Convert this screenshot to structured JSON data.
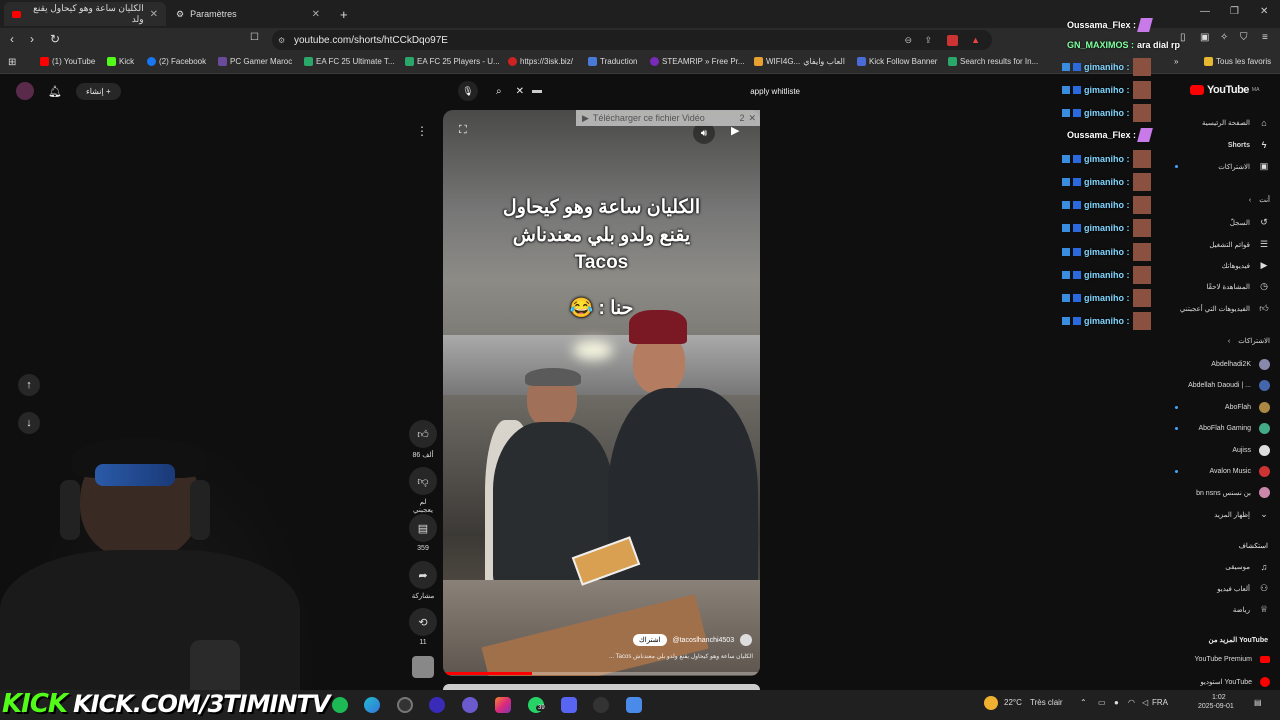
{
  "browser": {
    "tabs": [
      {
        "title": "الكليان ساعة وهو كيحاول يقنع ولد"
      },
      {
        "title": "Paramètres"
      }
    ],
    "url": "youtube.com/shorts/htCCkDqo97E",
    "bookmarks": [
      "(1) YouTube",
      "Kick",
      "(2) Facebook",
      "PC Gamer Maroc",
      "EA FC 25 Ultimate T...",
      "EA FC 25 Players - U...",
      "https://3isk.biz/",
      "Traduction",
      "STEAMRIP » Free Pr...",
      "WIFI4G...",
      "العاب وايفاي",
      "Kick Follow Banner",
      "Search results for In...",
      "Tous les favoris"
    ]
  },
  "youtube": {
    "create_label": "إنشاء",
    "search_value": "apply whitliste",
    "logo_text": "YouTube",
    "logo_suffix": "MA",
    "video": {
      "caption_line1": "الكليان ساعة وهو كيحاول",
      "caption_line2": "يقنع ولدو بلي معندناش",
      "caption_line3": "Tacos",
      "caption_line4": "حنا : 😂",
      "download_label": "Télécharger ce fichier Vidéo",
      "download_count": "2",
      "channel": "@tacoslhanchi4503",
      "subscribe": "اشتراك",
      "description": "الكليان ساعة وهو كيحاول يقنع ولدو بلي معندناش Tacos ..."
    },
    "actions": {
      "likes": "86 ألف",
      "dislike": "لم يعجبني",
      "comments": "359",
      "share": "مشاركة",
      "remix": "11"
    },
    "sidebar": {
      "main": [
        {
          "label": "الصفحة الرئيسية",
          "icon": "home-icon"
        },
        {
          "label": "Shorts",
          "icon": "shorts-icon"
        },
        {
          "label": "الاشتراكات",
          "icon": "subscriptions-icon"
        }
      ],
      "you_header": "أنت",
      "you": [
        {
          "label": "السجلّ",
          "icon": "history-icon"
        },
        {
          "label": "قوائم التشغيل",
          "icon": "playlist-icon"
        },
        {
          "label": "فيديوهاتك",
          "icon": "video-icon"
        },
        {
          "label": "المشاهدة لاحقًا",
          "icon": "clock-icon"
        },
        {
          "label": "الفيديوهات التي أعجبتني",
          "icon": "like-icon"
        }
      ],
      "subs_header": "الاشتراكات",
      "subs": [
        "Abdelhadi2K",
        "Abdellah Daoudi | ...",
        "AboFlah",
        "AboFlah Gaming",
        "Aujiss",
        "Avalon Music",
        "bn nsns بن نسنس"
      ],
      "show_more": "إظهار المزيد",
      "explore_header": "استكشاف",
      "explore": [
        {
          "label": "موسيقى",
          "icon": "music-icon"
        },
        {
          "label": "ألعاب فيديو",
          "icon": "gaming-icon"
        },
        {
          "label": "رياضة",
          "icon": "trophy-icon"
        }
      ],
      "more_header": "المزيد من YouTube",
      "more": [
        "YouTube Premium",
        "استوديو YouTube"
      ]
    }
  },
  "chat": [
    {
      "user": "Oussama_Flex :",
      "msg": ""
    },
    {
      "user": "GN_MAXIMOS :",
      "msg": "ara dial rp"
    },
    {
      "user": "gimaniho :",
      "msg": ""
    },
    {
      "user": "gimaniho :",
      "msg": ""
    },
    {
      "user": "gimaniho :",
      "msg": ""
    },
    {
      "user": "Oussama_Flex :",
      "msg": ""
    },
    {
      "user": "gimaniho :",
      "msg": ""
    },
    {
      "user": "gimaniho :",
      "msg": ""
    },
    {
      "user": "gimaniho :",
      "msg": ""
    },
    {
      "user": "gimaniho :",
      "msg": ""
    },
    {
      "user": "gimaniho :",
      "msg": ""
    },
    {
      "user": "gimaniho :",
      "msg": ""
    },
    {
      "user": "gimaniho :",
      "msg": ""
    },
    {
      "user": "gimaniho :",
      "msg": ""
    }
  ],
  "stream_overlay": {
    "kick_text": "KICK",
    "channel_url": "KICK.COM/3TIMINTV"
  },
  "taskbar": {
    "weather_temp": "22°C",
    "weather_text": "Très clair",
    "lang": "FRA",
    "time": "1:02",
    "date": "2025-09-01",
    "whatsapp_badge": "39"
  },
  "colors": {
    "kick_green": "#53fc18",
    "yt_red": "#ff0000",
    "chat_blue": "#7fd6ff"
  }
}
